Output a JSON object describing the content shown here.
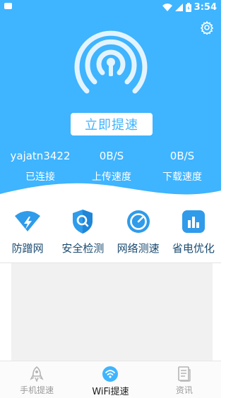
{
  "status_bar": {
    "time": "3:54"
  },
  "hero": {
    "boost_button": "立即提速",
    "stats": [
      {
        "value": "yajatn3422",
        "label": "已连接"
      },
      {
        "value": "0B/S",
        "label": "上传速度"
      },
      {
        "value": "0B/S",
        "label": "下载速度"
      }
    ]
  },
  "tools": [
    {
      "label": "防蹭网",
      "icon": "wifi-shield-icon"
    },
    {
      "label": "安全检测",
      "icon": "security-scan-icon"
    },
    {
      "label": "网络测速",
      "icon": "speed-gauge-icon"
    },
    {
      "label": "省电优化",
      "icon": "battery-chart-icon"
    }
  ],
  "tabs": [
    {
      "label": "手机提速",
      "icon": "rocket-icon",
      "active": false
    },
    {
      "label": "WiFi提速",
      "icon": "wifi-icon",
      "active": true
    },
    {
      "label": "资讯",
      "icon": "news-icon",
      "active": false
    }
  ],
  "colors": {
    "accent": "#3fb4ff",
    "tool_label": "#1a4b70",
    "tab_inactive": "#9a9a9a"
  }
}
